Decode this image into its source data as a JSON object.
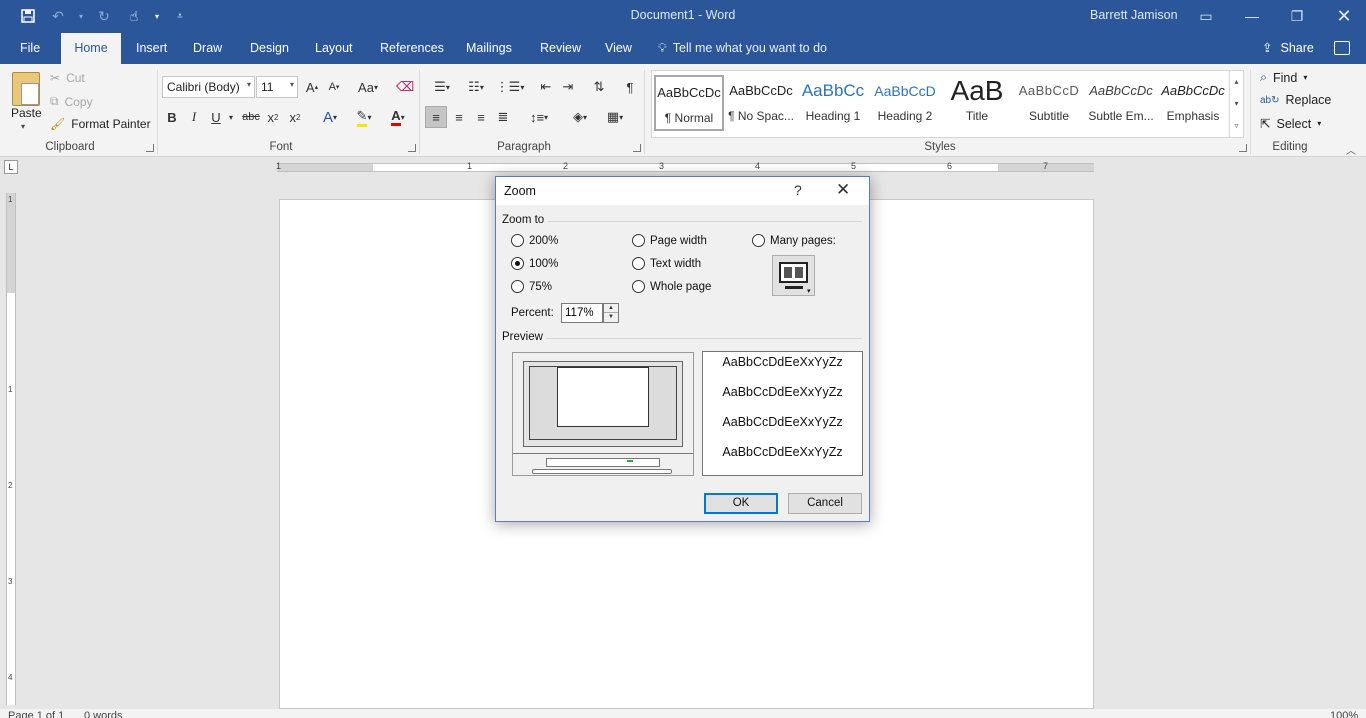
{
  "window": {
    "doc_title": "Document1 - Word",
    "user": "Barrett Jamison"
  },
  "tabs": [
    "File",
    "Home",
    "Insert",
    "Draw",
    "Design",
    "Layout",
    "References",
    "Mailings",
    "Review",
    "View"
  ],
  "active_tab": "Home",
  "tell_me": "Tell me what you want to do",
  "share": "Share",
  "ribbon": {
    "clipboard": {
      "label": "Clipboard",
      "paste": "Paste",
      "cut": "Cut",
      "copy": "Copy",
      "format_painter": "Format Painter"
    },
    "font": {
      "label": "Font",
      "font_name": "Calibri (Body)",
      "font_size": "11"
    },
    "paragraph": {
      "label": "Paragraph"
    },
    "styles": {
      "label": "Styles",
      "items": [
        {
          "sample": "AaBbCcDc",
          "name": "¶ Normal"
        },
        {
          "sample": "AaBbCcDc",
          "name": "¶ No Spac..."
        },
        {
          "sample": "AaBbCc",
          "name": "Heading 1"
        },
        {
          "sample": "AaBbCcD",
          "name": "Heading 2"
        },
        {
          "sample": "AaB",
          "name": "Title"
        },
        {
          "sample": "AaBbCcD",
          "name": "Subtitle"
        },
        {
          "sample": "AaBbCcDc",
          "name": "Subtle Em..."
        },
        {
          "sample": "AaBbCcDc",
          "name": "Emphasis"
        }
      ],
      "selected": "¶ Normal"
    },
    "editing": {
      "label": "Editing",
      "find": "Find",
      "replace": "Replace",
      "select": "Select"
    }
  },
  "ruler": {
    "marks": [
      "1",
      "1",
      "2",
      "3",
      "4",
      "5",
      "6",
      "7"
    ],
    "vmarks": [
      "1",
      "1",
      "2",
      "3",
      "4"
    ]
  },
  "statusbar": {
    "page": "Page 1 of 1",
    "words": "0 words",
    "zoom": "100%"
  },
  "zoom_dialog": {
    "title": "Zoom",
    "help": "?",
    "zoom_to_label": "Zoom to",
    "options": {
      "p200": "200%",
      "p100": "100%",
      "p75": "75%",
      "page_width": "Page width",
      "text_width": "Text width",
      "whole_page": "Whole page",
      "many_pages": "Many pages:"
    },
    "selected_option": "100%",
    "percent_label": "Percent:",
    "percent_value": "117%",
    "preview_label": "Preview",
    "preview_lines": [
      "AaBbCcDdEeXxYyZz",
      "AaBbCcDdEeXxYyZz",
      "AaBbCcDdEeXxYyZz",
      "AaBbCcDdEeXxYyZz"
    ],
    "ok": "OK",
    "cancel": "Cancel"
  },
  "colors": {
    "title_blue": "#2b579a",
    "ribbon_bg": "#f3f3f3",
    "dialog_bg": "#f0f0f0",
    "focus_blue": "#0078d7"
  }
}
